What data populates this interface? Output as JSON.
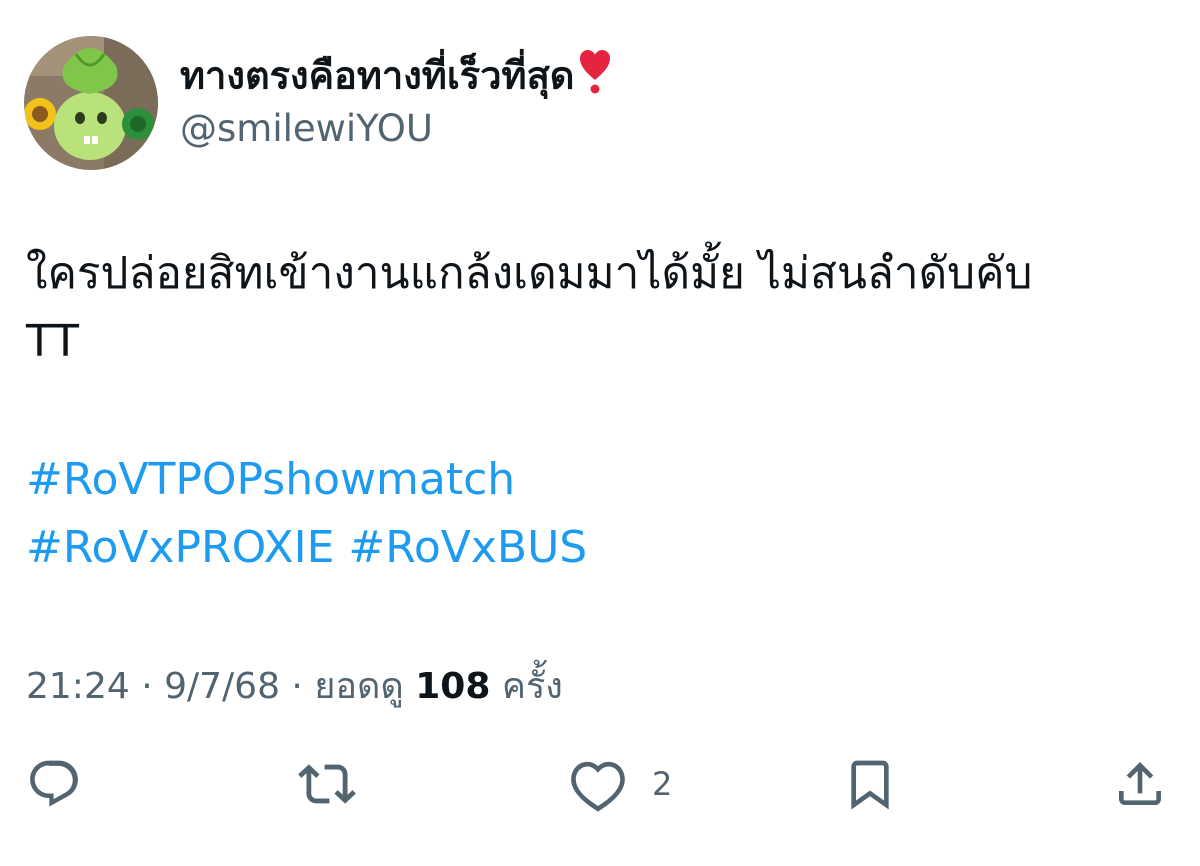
{
  "author": {
    "display_name": "ทางตรงคือทางที่เร็วที่สุด",
    "name_emoji_icon": "heart-exclamation-icon",
    "handle": "@smilewiYOU",
    "avatar_icon": "plant-character-avatar"
  },
  "tweet": {
    "text_line1": "ใครปล่อยสิทเข้างานแกล้งเดมมาได้มั้ย ไม่สนลำดับคับ",
    "text_line2": "TT",
    "hashtags": [
      "#RoVTPOPshowmatch",
      "#RoVxPROXIE",
      "#RoVxBUS"
    ]
  },
  "meta": {
    "time": "21:24",
    "separator": " · ",
    "date": "9/7/68",
    "views_prefix": "ยอดดู",
    "views_count": "108",
    "views_suffix": "ครั้ง"
  },
  "actions": {
    "reply_icon": "reply-icon",
    "retweet_icon": "retweet-icon",
    "like_icon": "heart-icon",
    "like_count": "2",
    "bookmark_icon": "bookmark-icon",
    "share_icon": "share-icon"
  },
  "colors": {
    "text_primary": "#0f1419",
    "text_secondary": "#536471",
    "link": "#1d9bf0",
    "heart_red": "#e5253f"
  }
}
